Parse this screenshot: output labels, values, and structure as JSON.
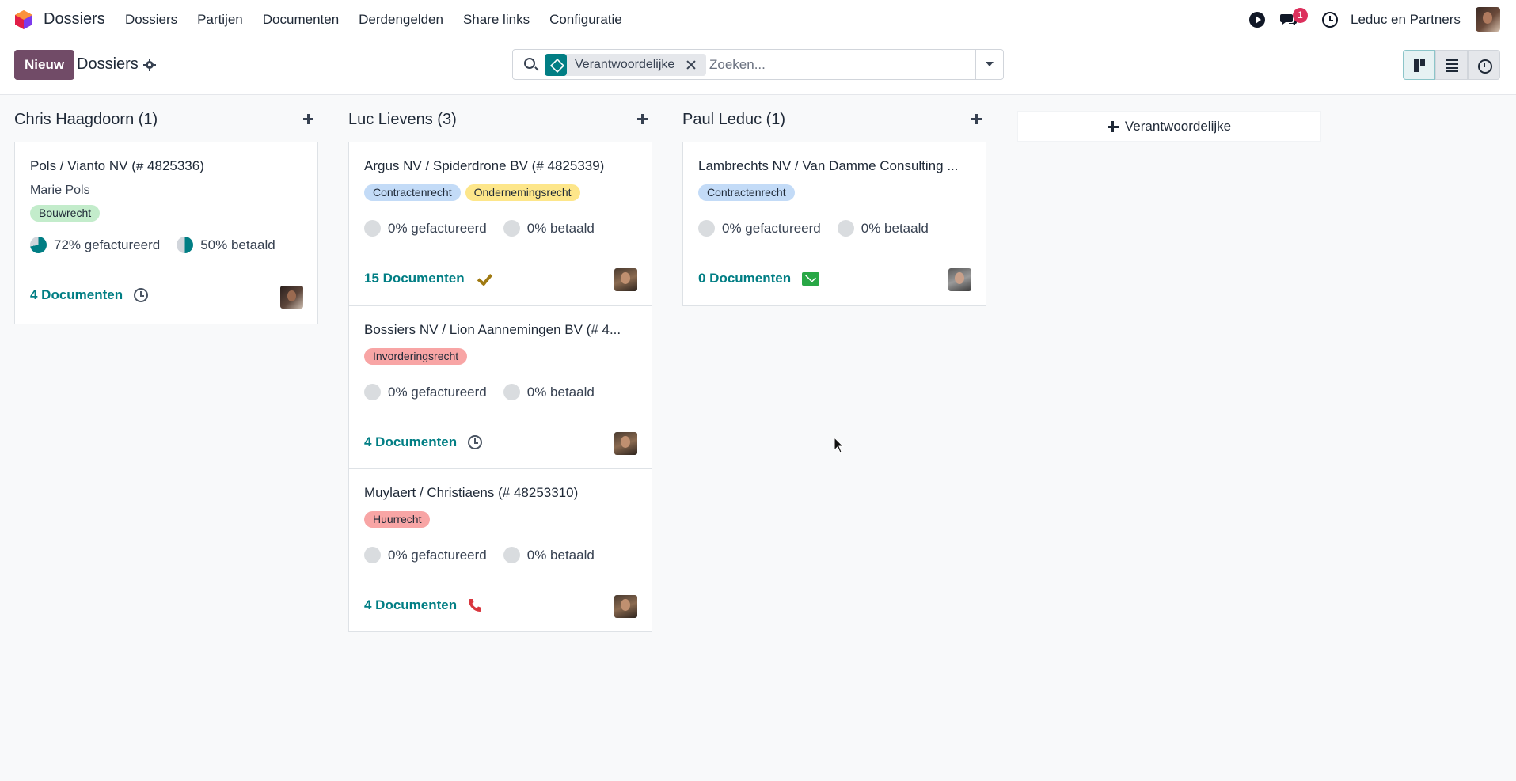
{
  "navbar": {
    "app_name": "Dossiers",
    "menu": [
      "Dossiers",
      "Partijen",
      "Documenten",
      "Derdengelden",
      "Share links",
      "Configuratie"
    ],
    "message_count": "1",
    "company": "Leduc en Partners"
  },
  "control": {
    "new_label": "Nieuw",
    "breadcrumb": "Dossiers",
    "facet_label": "Verantwoordelijke",
    "search_placeholder": "Zoeken..."
  },
  "columns": [
    {
      "title": "Chris Haagdoorn (1)",
      "cards": [
        {
          "title": "Pols / Vianto NV (# 4825336)",
          "subtitle": "Marie Pols",
          "tags": [
            {
              "label": "Bouwrecht",
              "color": "#c3eccb"
            }
          ],
          "invoiced": "72% gefactureerd",
          "invoiced_fraction": 0.72,
          "paid": "50% betaald",
          "paid_fraction": 0.5,
          "documents": "4 Documenten",
          "activity": "clock-icon",
          "avatar": "chris"
        }
      ]
    },
    {
      "title": "Luc Lievens (3)",
      "cards": [
        {
          "title": "Argus NV / Spiderdrone BV (# 4825339)",
          "tags": [
            {
              "label": "Contractenrecht",
              "color": "#c3dbf7"
            },
            {
              "label": "Ondernemingsrecht",
              "color": "#fde68a"
            }
          ],
          "invoiced": "0% gefactureerd",
          "invoiced_fraction": 0,
          "paid": "0% betaald",
          "paid_fraction": 0,
          "documents": "15 Documenten",
          "activity": "check-icon",
          "avatar": "luc"
        },
        {
          "title": "Bossiers NV / Lion Aannemingen BV (# 4...",
          "tags": [
            {
              "label": "Invorderingsrecht",
              "color": "#f8a5a5"
            }
          ],
          "invoiced": "0% gefactureerd",
          "invoiced_fraction": 0,
          "paid": "0% betaald",
          "paid_fraction": 0,
          "documents": "4 Documenten",
          "activity": "clock-icon",
          "avatar": "luc"
        },
        {
          "title": "Muylaert / Christiaens (# 48253310)",
          "tags": [
            {
              "label": "Huurrecht",
              "color": "#f8a5a5"
            }
          ],
          "invoiced": "0% gefactureerd",
          "invoiced_fraction": 0,
          "paid": "0% betaald",
          "paid_fraction": 0,
          "documents": "4 Documenten",
          "activity": "phone-icon",
          "avatar": "luc"
        }
      ]
    },
    {
      "title": "Paul Leduc (1)",
      "cards": [
        {
          "title": "Lambrechts NV / Van Damme Consulting ...",
          "tags": [
            {
              "label": "Contractenrecht",
              "color": "#c3dbf7"
            }
          ],
          "invoiced": "0% gefactureerd",
          "invoiced_fraction": 0,
          "paid": "0% betaald",
          "paid_fraction": 0,
          "documents": "0 Documenten",
          "activity": "mail-icon",
          "avatar": "paul"
        }
      ]
    }
  ],
  "add_column_label": "Verantwoordelijke",
  "colors": {
    "brand": "#714b67",
    "accent": "#017e84",
    "badge": "#dc2f5c"
  }
}
